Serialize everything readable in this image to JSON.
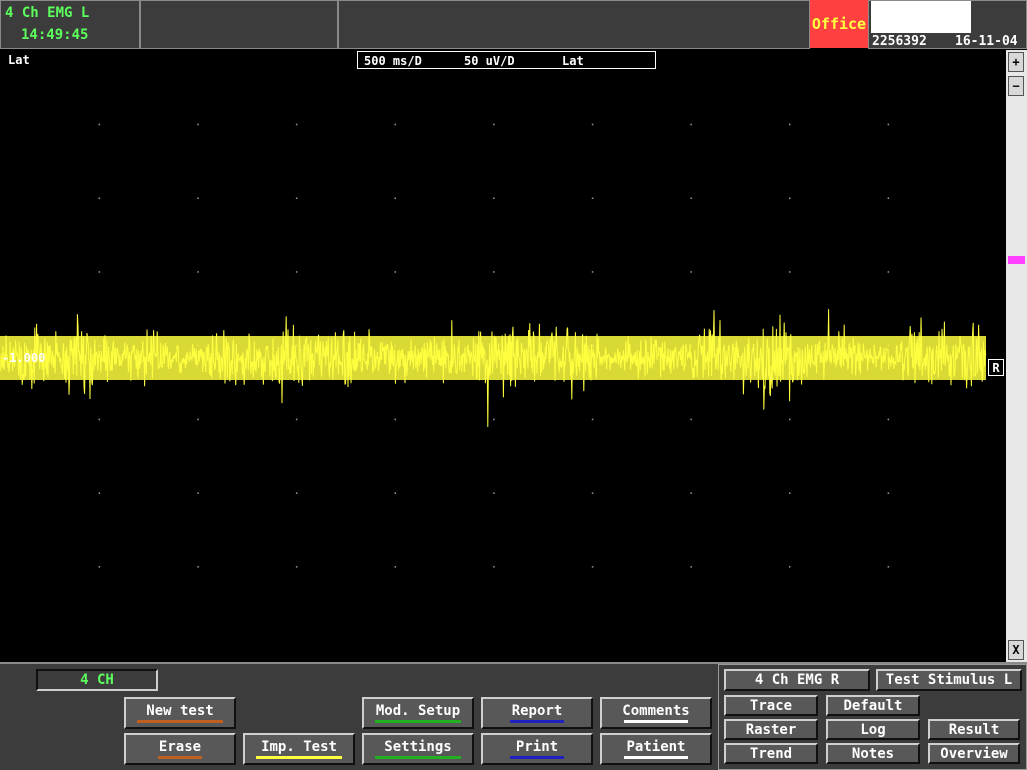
{
  "header": {
    "program": "4 Ch EMG L",
    "time": "14:49:45",
    "location": "Office",
    "patient_id": "2256392",
    "date": "16-11-04"
  },
  "plot": {
    "corner_label": "Lat",
    "time_base": "500 ms/D",
    "sensitivity": "50 uV/D",
    "mode": "Lat",
    "baseline_value": "-1.000",
    "ref_marker": "R",
    "trace_color": "#ffff40",
    "scroll": {
      "up": "+",
      "down": "−",
      "close": "X",
      "marker_color": "#ff40ff"
    }
  },
  "channel_selector": "4 CH",
  "buttons": {
    "new_test": {
      "label": "New test",
      "color": "#c06020"
    },
    "erase": {
      "label": "Erase",
      "color": "#c06020"
    },
    "imp_test": {
      "label": "Imp. Test",
      "color": "#ffff40"
    },
    "mod_setup": {
      "label": "Mod. Setup",
      "color": "#20b020"
    },
    "settings": {
      "label": "Settings",
      "color": "#20b020"
    },
    "report": {
      "label": "Report",
      "color": "#2020c0"
    },
    "print": {
      "label": "Print",
      "color": "#2020c0"
    },
    "comments": {
      "label": "Comments",
      "color": "#ffffff"
    },
    "patient": {
      "label": "Patient",
      "color": "#ffffff"
    }
  },
  "right_panel": {
    "channel": "4 Ch EMG R",
    "test_stimulus": "Test Stimulus L",
    "trace": "Trace",
    "raster": "Raster",
    "trend": "Trend",
    "default": "Default",
    "log": "Log",
    "notes": "Notes",
    "result": "Result",
    "overview": "Overview"
  }
}
